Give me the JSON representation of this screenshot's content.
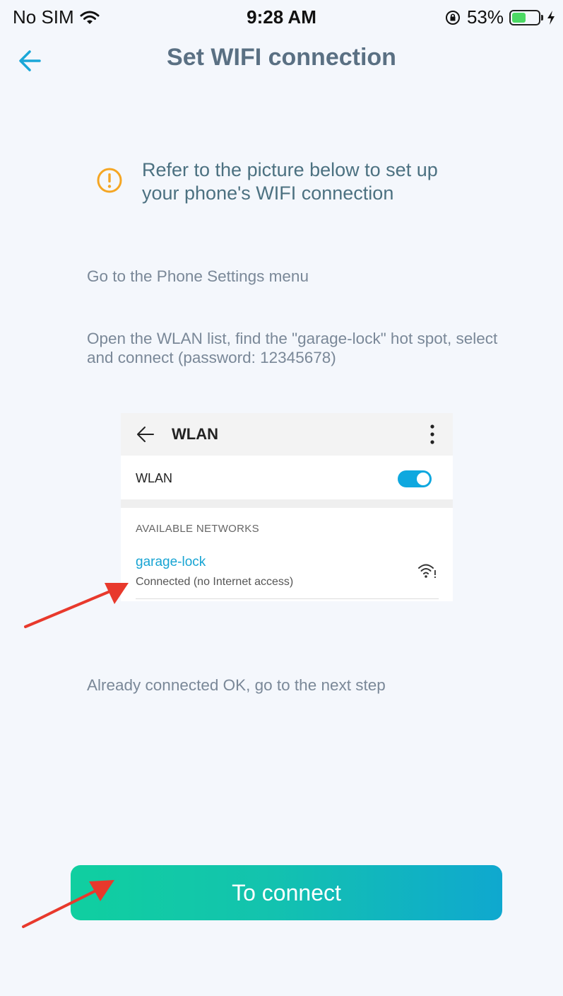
{
  "status_bar": {
    "carrier": "No SIM",
    "time": "9:28 AM",
    "battery_percent": "53%",
    "battery_level": 0.53,
    "icons": [
      "wifi-icon",
      "orientation-lock-icon",
      "battery-icon",
      "charging-icon"
    ]
  },
  "header": {
    "title": "Set WIFI connection",
    "back_icon": "back-arrow-icon"
  },
  "notice": {
    "icon": "warning-icon",
    "text": "Refer to the picture below to set up your phone's WIFI connection"
  },
  "steps": [
    "Go to the Phone Settings menu",
    "Open the WLAN list, find the \"garage-lock\" hot spot, select and connect (password: 12345678)",
    "Already connected OK, go to the next step"
  ],
  "wlan_screenshot": {
    "title": "WLAN",
    "toggle_label": "WLAN",
    "toggle_on": true,
    "section_title": "AVAILABLE NETWORKS",
    "network": {
      "name": "garage-lock",
      "status": "Connected (no Internet access)"
    }
  },
  "connect_button": {
    "label": "To connect"
  },
  "colors": {
    "background": "#f4f7fc",
    "accent": "#17a4d3",
    "button_gradient_start": "#10cfa0",
    "button_gradient_end": "#0fa8cf",
    "warning": "#f5a623",
    "annotation_arrow": "#e8392c"
  }
}
